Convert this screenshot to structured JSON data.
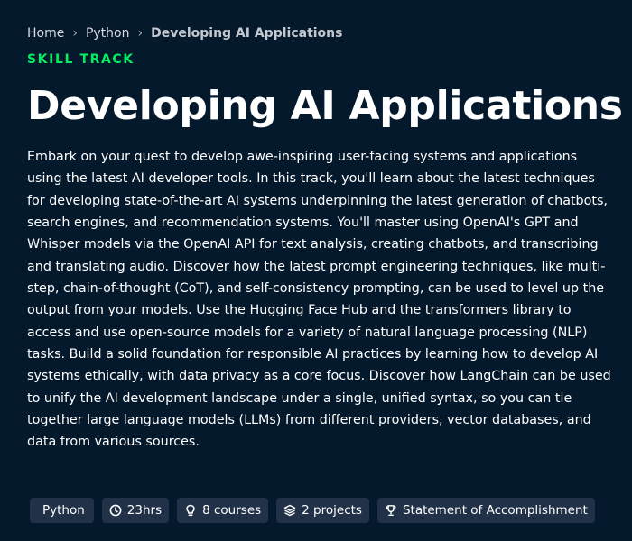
{
  "breadcrumb": {
    "items": [
      "Home",
      "Python"
    ],
    "separator": "›",
    "current": "Developing AI Applications"
  },
  "eyebrow": "SKILL TRACK",
  "title": "Developing AI Applications",
  "description": "Embark on your quest to develop awe-inspiring user-facing systems and applications using the latest AI developer tools. In this track, you'll learn about the latest techniques for developing state-of-the-art AI systems underpinning the latest generation of chatbots, search engines, and recommendation systems. You'll master using OpenAI's GPT and Whisper models via the OpenAI API for text analysis, creating chatbots, and transcribing and translating audio. Discover how the latest prompt engineering techniques, like multi-step, chain-of-thought (CoT), and self-consistency prompting, can be used to level up the output from your models. Use the Hugging Face Hub and the transformers library to access and use open-source models for a variety of natural language processing (NLP) tasks. Build a solid foundation for responsible AI practices by learning how to develop AI systems ethically, with data privacy as a core focus. Discover how LangChain can be used to unify the AI development landscape under a single, unified syntax, so you can tie together large language models (LLMs) from different providers, vector databases, and data from various sources.",
  "tags": [
    {
      "label": "Python",
      "icon": null
    },
    {
      "label": "23hrs",
      "icon": "clock-icon"
    },
    {
      "label": "8 courses",
      "icon": "lightbulb-icon"
    },
    {
      "label": "2 projects",
      "icon": "layers-icon"
    },
    {
      "label": "Statement of Accomplishment",
      "icon": "trophy-icon"
    }
  ],
  "colors": {
    "background": "#05192d",
    "accent": "#03ef62",
    "tag_background": "#213147",
    "text": "#ffffff"
  }
}
